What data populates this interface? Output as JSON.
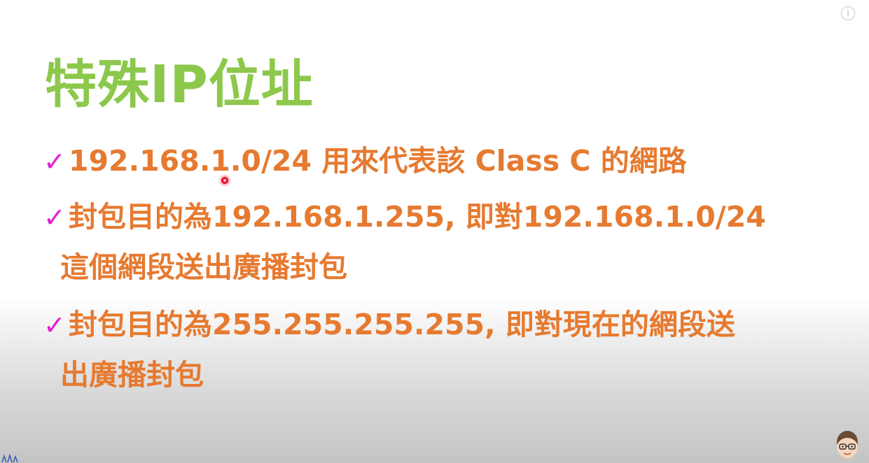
{
  "info_icon": {
    "glyph": "i",
    "icon": "info-icon"
  },
  "title": "特殊IP位址",
  "bullets": [
    {
      "check": "✓",
      "lines": [
        "192.168.1.0/24 用來代表該 Class C 的網路"
      ]
    },
    {
      "check": "✓",
      "lines": [
        "封包目的為192.168.1.255, 即對192.168.1.0/24",
        "這個網段送出廣播封包"
      ]
    },
    {
      "check": "✓",
      "lines": [
        "封包目的為255.255.255.255, 即對現在的網段送",
        "出廣播封包"
      ]
    }
  ],
  "colors": {
    "title": "#8cc84b",
    "bullet_text": "#e67a30",
    "check": "#e21fd2",
    "laser_pointer": "#e0102a"
  }
}
